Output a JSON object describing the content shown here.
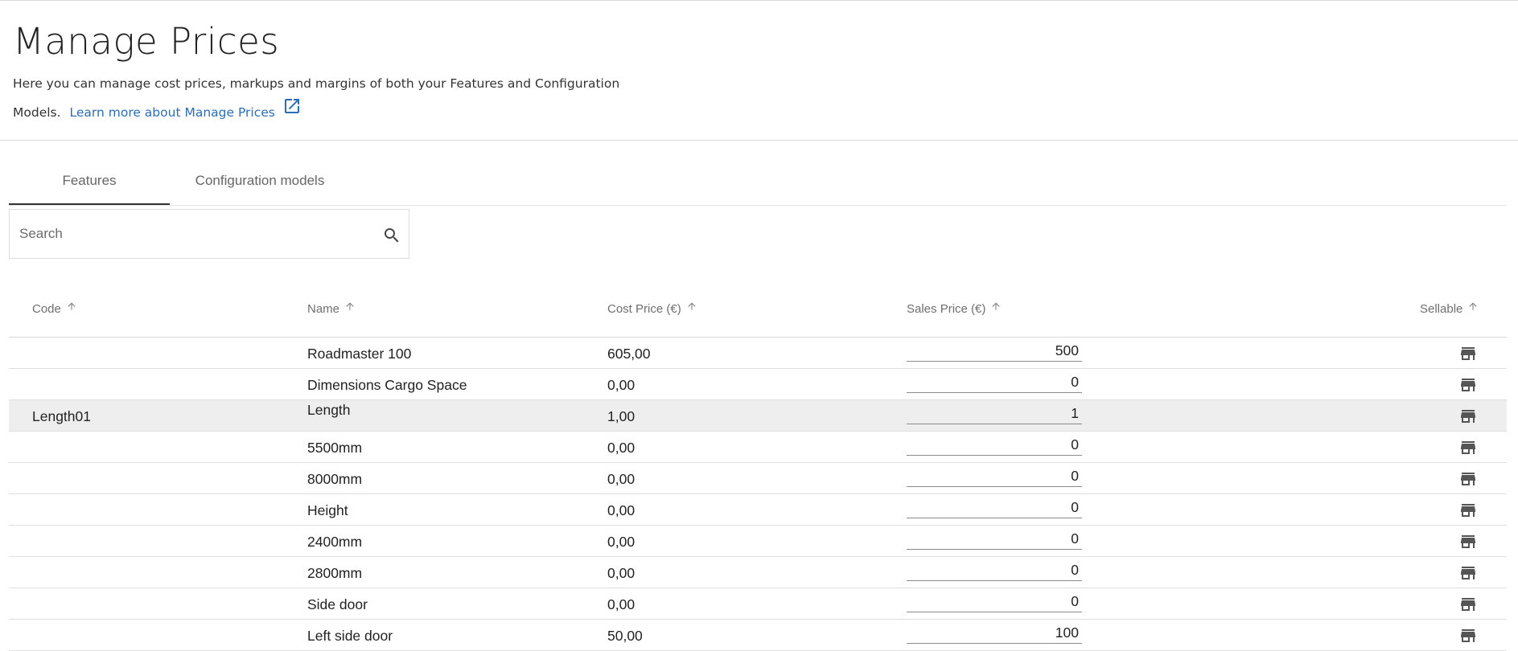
{
  "header": {
    "title": "Manage Prices",
    "description_line1": "Here you can manage cost prices, markups and margins of both your Features and Configuration",
    "description_line2": "Models.",
    "learn_more_label": "Learn more about Manage Prices",
    "external_icon": "open-in-new-icon"
  },
  "tabs": [
    {
      "label": "Features",
      "active": true
    },
    {
      "label": "Configuration models",
      "active": false
    }
  ],
  "search": {
    "placeholder": "Search",
    "value": "",
    "icon": "search-icon"
  },
  "table": {
    "columns": [
      {
        "label": "Code",
        "sort_icon": "arrow-up-icon"
      },
      {
        "label": "Name",
        "sort_icon": "arrow-up-icon"
      },
      {
        "label": "Cost Price (€)",
        "sort_icon": "arrow-up-icon"
      },
      {
        "label": "Sales Price (€)",
        "sort_icon": "arrow-up-icon"
      },
      {
        "label": "Sellable",
        "sort_icon": "arrow-up-icon"
      }
    ],
    "rows": [
      {
        "code": "",
        "name": "Roadmaster 100",
        "cost": "605,00",
        "sales": "500",
        "sellable_icon": "store-icon",
        "highlighted": false
      },
      {
        "code": "",
        "name": "Dimensions Cargo Space",
        "cost": "0,00",
        "sales": "0",
        "sellable_icon": "store-icon",
        "highlighted": false
      },
      {
        "code": "Length01",
        "name": "Length",
        "cost": "1,00",
        "sales": "1",
        "sellable_icon": "store-icon",
        "highlighted": true
      },
      {
        "code": "",
        "name": "5500mm",
        "cost": "0,00",
        "sales": "0",
        "sellable_icon": "store-icon",
        "highlighted": false
      },
      {
        "code": "",
        "name": "8000mm",
        "cost": "0,00",
        "sales": "0",
        "sellable_icon": "store-icon",
        "highlighted": false
      },
      {
        "code": "",
        "name": "Height",
        "cost": "0,00",
        "sales": "0",
        "sellable_icon": "store-icon",
        "highlighted": false
      },
      {
        "code": "",
        "name": "2400mm",
        "cost": "0,00",
        "sales": "0",
        "sellable_icon": "store-icon",
        "highlighted": false
      },
      {
        "code": "",
        "name": "2800mm",
        "cost": "0,00",
        "sales": "0",
        "sellable_icon": "store-icon",
        "highlighted": false
      },
      {
        "code": "",
        "name": "Side door",
        "cost": "0,00",
        "sales": "0",
        "sellable_icon": "store-icon",
        "highlighted": false
      },
      {
        "code": "",
        "name": "Left side door",
        "cost": "50,00",
        "sales": "100",
        "sellable_icon": "store-icon",
        "highlighted": false
      }
    ]
  },
  "colors": {
    "link": "#2d6db5",
    "row_highlight": "#eeeeee",
    "icon": "#555555",
    "header_text": "#6f6f6f"
  }
}
